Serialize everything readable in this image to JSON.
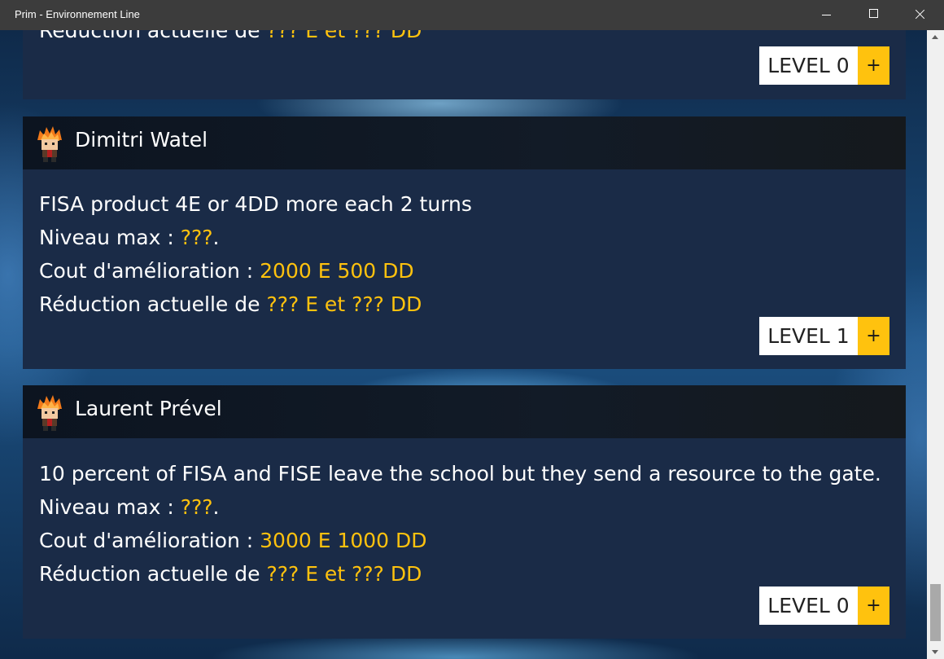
{
  "window": {
    "title": "Prim - Environnement Line"
  },
  "cards": [
    {
      "name": "",
      "description": "",
      "max_level_label": "",
      "max_level_value": "",
      "cost_label": "",
      "cost_value": "",
      "reduction_label": "Réduction actuelle de",
      "reduction_value": "??? E et ??? DD",
      "level_label": "LEVEL 0",
      "plus_label": "+"
    },
    {
      "name": "Dimitri Watel",
      "description": "FISA product 4E or 4DD more each 2 turns",
      "max_level_label": "Niveau max :",
      "max_level_value": "???",
      "cost_label": "Cout d'amélioration :",
      "cost_value": "2000 E 500 DD",
      "reduction_label": "Réduction actuelle de",
      "reduction_value": "??? E et ??? DD",
      "level_label": "LEVEL 1",
      "plus_label": "+"
    },
    {
      "name": "Laurent Prével",
      "description": "10 percent of FISA and FISE leave the school but they send a resource to the gate.",
      "max_level_label": "Niveau max :",
      "max_level_value": "???",
      "cost_label": "Cout d'amélioration :",
      "cost_value": "3000 E 1000 DD",
      "reduction_label": "Réduction actuelle de",
      "reduction_value": "??? E et ??? DD",
      "level_label": "LEVEL 0",
      "plus_label": "+"
    }
  ],
  "colors": {
    "accent": "#ffc20e",
    "card_bg": "#1a2b47",
    "header_bg": "#0e1722",
    "titlebar": "#3c3c3c"
  },
  "icons": {
    "avatar": "character-sprite-icon"
  }
}
